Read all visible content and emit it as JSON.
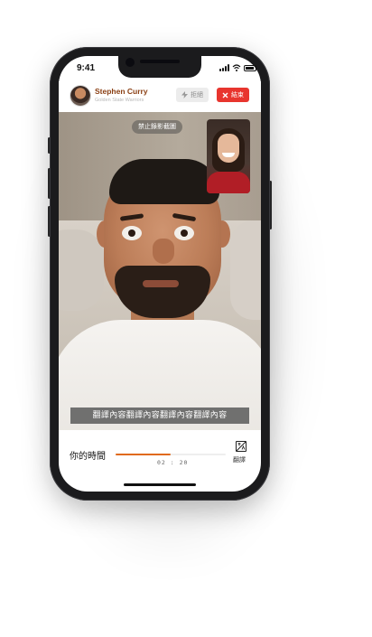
{
  "status_bar": {
    "time": "9:41"
  },
  "header": {
    "caller_name": "Stephen Curry",
    "caller_subtitle": "Golden State Warriors",
    "reject_label": "拒絕",
    "end_label": "結束",
    "colors": {
      "name": "#8a3f13",
      "end_button": "#e8352e"
    }
  },
  "video": {
    "no_record_notice": "禁止錄影截圖",
    "subtitle": "翻譯內容翻譯內容翻譯內容翻譯內容"
  },
  "bottom_bar": {
    "your_time_label": "你的時間",
    "elapsed": "02 : 20",
    "progress": 0.5,
    "translate_label": "翻譯",
    "colors": {
      "progress": "#e06a1c"
    }
  },
  "icons": [
    "signal-icon",
    "wifi-icon",
    "battery-icon",
    "avatar",
    "lightning-icon",
    "close-icon",
    "translate-icon"
  ]
}
